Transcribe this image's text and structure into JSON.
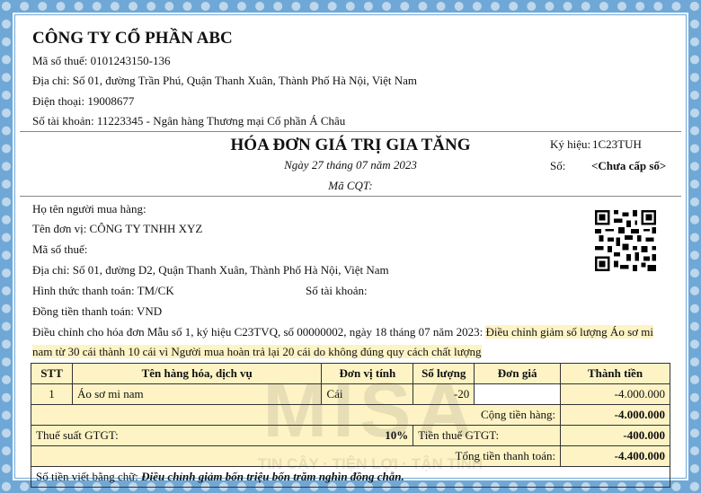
{
  "seller": {
    "company": "CÔNG TY CỔ PHẦN ABC",
    "tax_code": "Mã số thuế: 0101243150-136",
    "address": "Địa chỉ: Số 01, đường Trần Phú, Quận Thanh Xuân, Thành Phố Hà Nội, Việt Nam",
    "phone": "Điện thoại: 19008677",
    "account": "Số tài khoản: 11223345 - Ngân hàng Thương mại Cổ phần Á Châu"
  },
  "invoice": {
    "title": "HÓA ĐƠN GIÁ TRỊ GIA TĂNG",
    "date": "Ngày 27 tháng 07 năm 2023",
    "mcqt": "Mã CQT:",
    "symbol_label": "Ký hiệu:",
    "symbol_value": "1C23TUH",
    "number_label": "Số:",
    "number_value": "<Chưa cấp số>"
  },
  "buyer": {
    "name": "Họ tên người mua hàng:",
    "unit": "Tên đơn vị: CÔNG TY TNHH XYZ",
    "tax_code": "Mã số thuế:",
    "address": "Địa chỉ: Số 01, đường D2, Quận Thanh Xuân, Thành Phố Hà Nội, Việt Nam",
    "payment": "Hình thức thanh toán: TM/CK",
    "account": "Số tài khoản:",
    "currency": "Đồng tiền thanh toán: VND"
  },
  "adjust": {
    "prefix": "Điều chỉnh cho hóa đơn Mẫu số 1, ký hiệu C23TVQ, số 00000002, ngày 18 tháng 07 năm 2023:",
    "highlight1": "Điều chỉnh giảm số lượng Áo sơ mi",
    "highlight2": "nam từ 30 cái thành 10 cái vì Người mua hoàn trả lại 20 cái do không đúng quy cách chất lượng"
  },
  "table": {
    "headers": [
      "STT",
      "Tên hàng hóa, dịch vụ",
      "Đơn vị tính",
      "Số lượng",
      "Đơn giá",
      "Thành tiền"
    ],
    "row": {
      "stt": "1",
      "name": "Áo sơ mi nam",
      "unit": "Cái",
      "qty": "-20",
      "price": "",
      "amount": "-4.000.000"
    },
    "subtotal_label": "Cộng tiền hàng:",
    "subtotal_value": "-4.000.000",
    "vat_rate_label": "Thuế suất GTGT:",
    "vat_rate_value": "10%",
    "vat_amount_label": "Tiền thuế GTGT:",
    "vat_amount_value": "-400.000",
    "total_label": "Tổng tiền thanh toán:",
    "total_value": "-4.400.000"
  },
  "words": {
    "label": "Số tiền viết bằng chữ:",
    "value": "Điều chỉnh giảm bốn triệu bốn trăm nghìn đồng chẵn."
  },
  "watermark": {
    "logo_text": "MISA",
    "slogan": "TIN CẬY · TIỆN LỢI · TẬN TÌNH"
  },
  "colors": {
    "border": "#6fa8d6",
    "highlight": "#fdf3c4"
  }
}
